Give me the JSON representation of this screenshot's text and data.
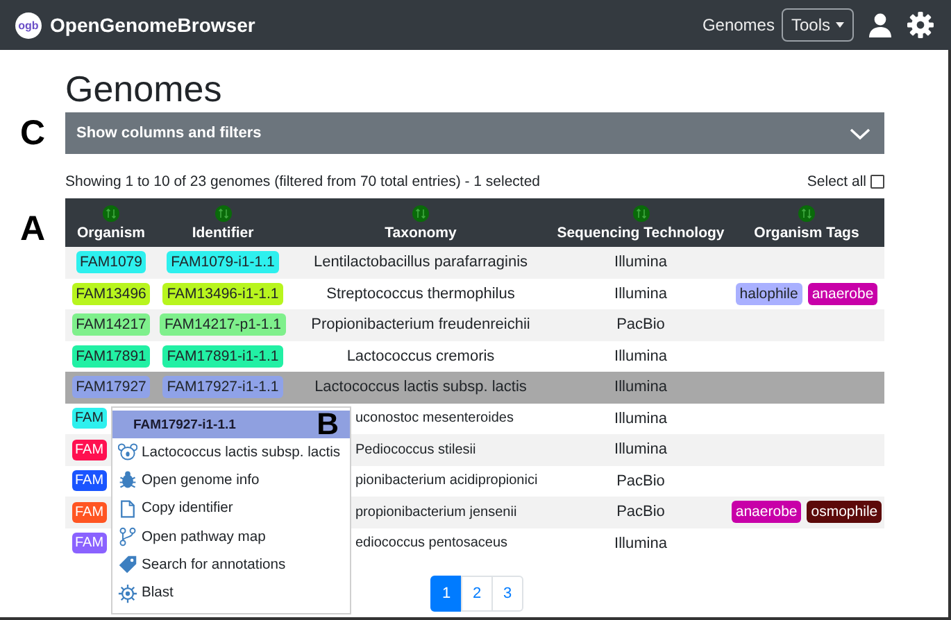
{
  "navbar": {
    "logo": "ogb",
    "brand": "OpenGenomeBrowser",
    "link": "Genomes",
    "tools_button": "Tools"
  },
  "title": "Genomes",
  "filter_bar": {
    "marker": "C",
    "label": "Show columns and filters"
  },
  "info": {
    "text": "Showing 1 to 10 of 23 genomes (filtered from 70 total entries) - 1 selected",
    "select_all": "Select all",
    "select_all_checked": false
  },
  "table": {
    "marker": "A",
    "columns": [
      "Organism",
      "Identifier",
      "Taxonomy",
      "Sequencing Technology",
      "Organism Tags"
    ],
    "rows": [
      {
        "kind": "full",
        "organism": "FAM1079",
        "identifier": "FAM1079-i1-1.1",
        "taxonomy": "Lentilactobacillus parafarraginis",
        "sequencing": "Illumina",
        "color": "#2ef0ee",
        "selected": false,
        "tags": []
      },
      {
        "kind": "full",
        "organism": "FAM13496",
        "identifier": "FAM13496-i1-1.1",
        "taxonomy": "Streptococcus thermophilus",
        "sequencing": "Illumina",
        "color": "#b8f51e",
        "selected": false,
        "tags": [
          {
            "label": "halophile",
            "color": "#a9b0ff"
          },
          {
            "label": "anaerobe",
            "color": "#c800a8"
          }
        ]
      },
      {
        "kind": "full",
        "organism": "FAM14217",
        "identifier": "FAM14217-p1-1.1",
        "taxonomy": "Propionibacterium freudenreichii",
        "sequencing": "PacBio",
        "color": "#7ff08c",
        "selected": false,
        "tags": []
      },
      {
        "kind": "full",
        "organism": "FAM17891",
        "identifier": "FAM17891-i1-1.1",
        "taxonomy": "Lactococcus cremoris",
        "sequencing": "Illumina",
        "color": "#22f0a4",
        "selected": false,
        "tags": []
      },
      {
        "kind": "full",
        "organism": "FAM17927",
        "identifier": "FAM17927-i1-1.1",
        "taxonomy": "Lactococcus lactis subsp. lactis",
        "sequencing": "Illumina",
        "color": "#8fa2e8",
        "selected": true,
        "tags": []
      },
      {
        "kind": "covered",
        "organism": "FAM",
        "taxonomy": "uconostoc mesenteroides",
        "sequencing": "Illumina",
        "color": "#2ef0ee",
        "selected": false,
        "tags": []
      },
      {
        "kind": "covered",
        "organism": "FAM",
        "taxonomy": "Pediococcus stilesii",
        "sequencing": "Illumina",
        "color": "#ff1050",
        "selected": false,
        "tags": []
      },
      {
        "kind": "covered",
        "organism": "FAM",
        "taxonomy": "pionibacterium acidipropionici",
        "sequencing": "PacBio",
        "color": "#1a55ff",
        "selected": false,
        "tags": []
      },
      {
        "kind": "covered",
        "organism": "FAM",
        "taxonomy": "propionibacterium jensenii",
        "sequencing": "PacBio",
        "color": "#ff5522",
        "selected": false,
        "tags": [
          {
            "label": "anaerobe",
            "color": "#c800a8"
          },
          {
            "label": "osmophile",
            "color": "#5c0a0a"
          }
        ]
      },
      {
        "kind": "covered",
        "organism": "FAM",
        "taxonomy": "ediococcus pentosaceus",
        "sequencing": "Illumina",
        "color": "#8a62ff",
        "selected": false,
        "tags": []
      }
    ]
  },
  "pagination": [
    {
      "label": "1",
      "selected": true
    },
    {
      "label": "2",
      "selected": false
    },
    {
      "label": "3",
      "selected": false
    }
  ],
  "context_menu": {
    "title": "FAM17927-i1-1.1",
    "marker": "B",
    "items": [
      {
        "kind": "organism",
        "label": "Lactococcus lactis subsp. lactis"
      },
      {
        "kind": "info",
        "label": "Open genome info"
      },
      {
        "kind": "copy",
        "label": "Copy identifier"
      },
      {
        "kind": "pathway",
        "label": "Open pathway map"
      },
      {
        "kind": "annotations",
        "label": "Search for annotations"
      },
      {
        "kind": "blast",
        "label": "Blast"
      }
    ]
  }
}
